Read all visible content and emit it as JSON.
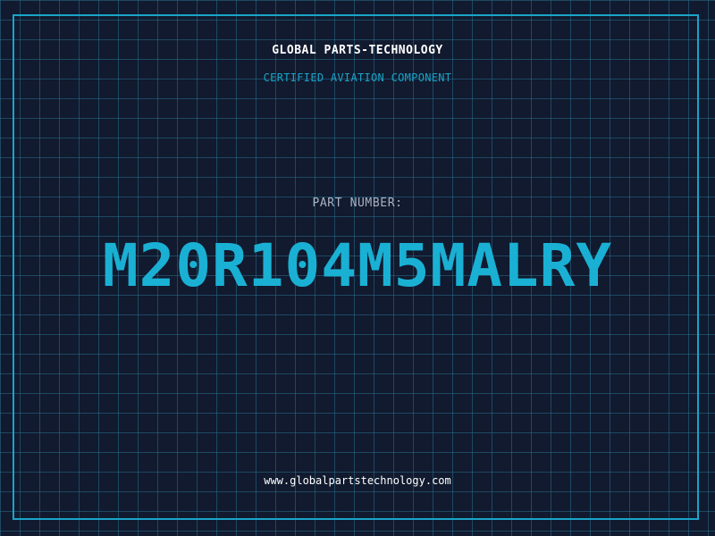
{
  "header": {
    "company_name": "GLOBAL PARTS-TECHNOLOGY",
    "tagline": "CERTIFIED AVIATION COMPONENT"
  },
  "main": {
    "part_label": "PART NUMBER:",
    "part_number": "M20R104M5MALRY"
  },
  "footer": {
    "website": "www.globalpartstechnology.com"
  },
  "colors": {
    "background": "#111a2e",
    "grid": "#286e8c",
    "accent": "#1aa4c8",
    "text": "#ffffff",
    "muted": "#a9b3c4"
  }
}
